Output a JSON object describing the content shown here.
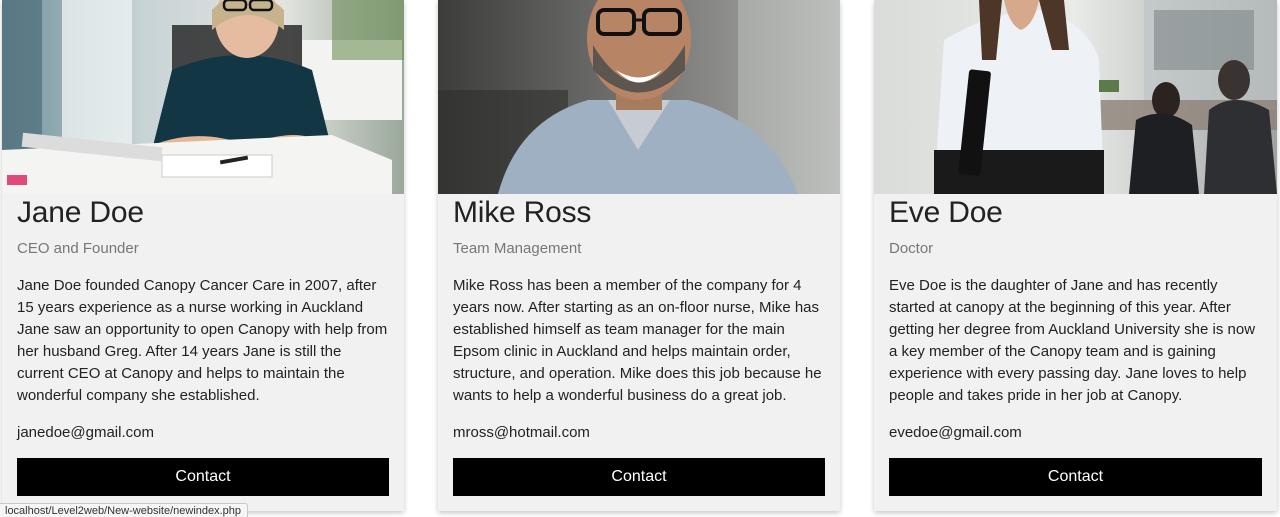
{
  "team": [
    {
      "name": "Jane Doe",
      "title": "CEO and Founder",
      "bio": "Jane Doe founded Canopy Cancer Care in 2007, after 15 years experience as a nurse working in Auckland Jane saw an opportunity to open Canopy with help from her husband Greg. After 14 years Jane is still the current CEO at Canopy and helps to maintain the wonderful company she established.",
      "email": "janedoe@gmail.com",
      "button": "Contact"
    },
    {
      "name": "Mike Ross",
      "title": "Team Management",
      "bio": "Mike Ross has been a member of the company for 4 years now. After starting as an on-floor nurse, Mike has established himself as team manager for the main Epsom clinic in Auckland and helps maintain order, structure, and operation. Mike does this job because he wants to help a wonderful business do a great job.",
      "email": "mross@hotmail.com",
      "button": "Contact"
    },
    {
      "name": "Eve Doe",
      "title": "Doctor",
      "bio": "Eve Doe is the daughter of Jane and has recently started at canopy at the beginning of this year. After getting her degree from Auckland University she is now a key member of the Canopy team and is gaining experience with every passing day. Jane loves to help people and takes pride in her job at Canopy.",
      "email": "evedoe@gmail.com",
      "button": "Contact"
    }
  ],
  "status_bar": {
    "url": "localhost/Level2web/New-website/newindex.php"
  }
}
